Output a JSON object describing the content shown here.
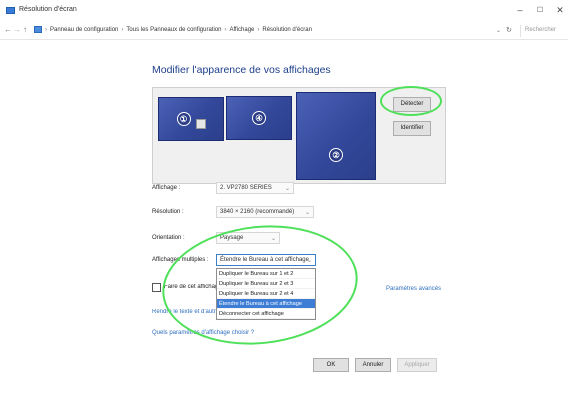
{
  "window": {
    "title": "Résolution d'écran",
    "controls": {
      "minimize": "–",
      "maximize": "☐",
      "close": "✕"
    }
  },
  "address": {
    "back": "←",
    "forward": "→",
    "up": "↑",
    "crumbs": [
      "Panneau de configuration",
      "Tous les Panneaux de configuration",
      "Affichage",
      "Résolution d'écran"
    ],
    "separator": "›",
    "refresh": "↻",
    "search_placeholder": "Rechercher"
  },
  "page": {
    "title": "Modifier l'apparence de vos affichages"
  },
  "monitors": [
    {
      "number": "①"
    },
    {
      "number": "④"
    },
    {
      "number": "②"
    }
  ],
  "buttons": {
    "detect": "Détecter",
    "identify": "Identifier",
    "ok": "OK",
    "cancel": "Annuler",
    "apply": "Appliquer"
  },
  "settings": {
    "display_label": "Affichage :",
    "display_value": "2. VP2780 SERIES",
    "resolution_label": "Résolution :",
    "resolution_value": "3840 × 2160 (recommandé)",
    "orientation_label": "Orientation :",
    "orientation_value": "Paysage",
    "multiple_label": "Affichages multiples :",
    "multiple_value": "Étendre le Bureau à cet affichage"
  },
  "dropdown_options": [
    "Dupliquer le Bureau sur 1 et 2",
    "Dupliquer le Bureau sur 2 et 3",
    "Dupliquer le Bureau sur 2 et 4",
    "Étendre le Bureau à cet affichage",
    "Déconnecter cet affichage"
  ],
  "selected_option_index": 3,
  "main_display_label": "Faire de cet affichage",
  "advanced_link": "Paramètres avancés",
  "text_size_link": "Rendre le texte et d'autres",
  "which_settings_link": "Quels paramètres d'affichage choisir ?",
  "colors": {
    "accent": "#3d7dd6",
    "annotation": "#4fe05a",
    "heading": "#1e3f8a",
    "monitor": "#3a4fa0"
  }
}
